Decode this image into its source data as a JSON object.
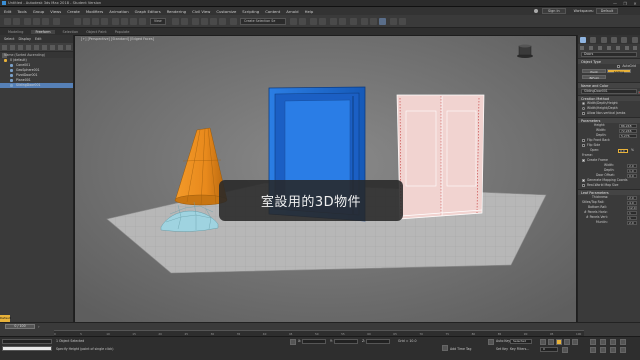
{
  "window": {
    "title": "Untitled - Autodesk 3ds Max 2018 - Student Version",
    "controls": [
      "—",
      "❐",
      "✕"
    ]
  },
  "menubar": {
    "items": [
      "Edit",
      "Tools",
      "Group",
      "Views",
      "Create",
      "Modifiers",
      "Animation",
      "Graph Editors",
      "Rendering",
      "Civil View",
      "Customize",
      "Scripting",
      "Content",
      "Arnold",
      "Help"
    ],
    "sign_in": "Sign In",
    "workspaces_label": "Workspaces:",
    "workspace_value": "Default"
  },
  "toolbar": {
    "view_dropdown": "View",
    "selection_set": "Create Selection Se"
  },
  "ribbon": {
    "tabs": [
      "Modeling",
      "Freeform",
      "Selection",
      "Object Paint",
      "Populate"
    ],
    "active_index": 1
  },
  "scene_explorer": {
    "tabs": [
      "Select",
      "Display",
      "Edit"
    ],
    "header": "Name (Sorted Ascending)",
    "root": "0 (default)",
    "items": [
      {
        "name": "Cone001",
        "selected": false
      },
      {
        "name": "GeoSphere001",
        "selected": false
      },
      {
        "name": "PivotDoor001",
        "selected": false
      },
      {
        "name": "Plane001",
        "selected": false
      },
      {
        "name": "SlidingDoor001",
        "selected": true
      }
    ]
  },
  "viewport": {
    "label": "[+] [Perspective] [Standard] [Edged Faces]",
    "subtitle": "室設用的3D物件"
  },
  "command_panel": {
    "category_dropdown": "Doors",
    "object_type": {
      "title": "Object Type",
      "autogrid": "AutoGrid",
      "buttons": [
        "Pivot",
        "Sliding",
        "BiFold"
      ],
      "active": "Sliding"
    },
    "name_and_color": {
      "title": "Name and Color",
      "name": "SlidingDoor001"
    },
    "creation_method": {
      "title": "Creation Method",
      "options": [
        "Width/Depth/Height",
        "Width/Height/Depth"
      ],
      "selected_index": 0,
      "allow_non_vertical": "Allow Non-vertical Jambs"
    },
    "parameters": {
      "title": "Parameters",
      "height_label": "Height:",
      "height": "86.248",
      "width_label": "Width:",
      "width": "72.246",
      "depth_label": "Depth:",
      "depth": "5.276",
      "flip_front_back": "Flip Front Back",
      "flip_side": "Flip Side",
      "open_label": "Open:",
      "open": "0.0",
      "open_unit": "%",
      "frame_label": "Frame:",
      "create_frame": "Create Frame",
      "frame_width_label": "Width:",
      "frame_width": "2.0",
      "frame_depth_label": "Depth:",
      "frame_depth": "1.0",
      "door_offset_label": "Door Offset:",
      "door_offset": "0.0",
      "generate_mapping": "Generate Mapping Coords",
      "real_world": "Real-World Map Size"
    },
    "leaf_parameters": {
      "title": "Leaf Parameters",
      "thickness_label": "Thickness:",
      "thickness": "2.0",
      "stiles_label": "Stiles/Top Rail:",
      "stiles": "4.0",
      "bottom_rail_label": "Bottom Rail:",
      "bottom_rail": "12.0",
      "panels_horiz_label": "# Panels Horiz:",
      "panels_horiz": "1",
      "panels_vert_label": "# Panels Vert:",
      "panels_vert": "1",
      "muntin_label": "Muntin:",
      "muntin": "2.0"
    }
  },
  "timeline": {
    "frame": "0 / 100",
    "orange_tab": "Default",
    "ticks": [
      "0",
      "5",
      "10",
      "15",
      "20",
      "25",
      "30",
      "35",
      "40",
      "45",
      "50",
      "55",
      "60",
      "65",
      "70",
      "75",
      "80",
      "85",
      "90",
      "95",
      "100"
    ]
  },
  "status_bar": {
    "selection": "1 Object Selected",
    "prompt": "Specify Height (point of single click)",
    "x_label": "X:",
    "y_label": "Y:",
    "z_label": "Z:",
    "grid": "Grid = 10.0",
    "add_time_tag": "Add Time Tag",
    "auto_key": "Auto Key",
    "selected": "Selected",
    "set_key": "Set Key",
    "key_filters": "Key Filters...",
    "frame_field": "0"
  },
  "colors": {
    "accent": "#e8b23a",
    "selection": "#5680b6",
    "viewport_bg": "#6b6b6b",
    "door_blue": "#1f6fd8",
    "cone_orange": "#e8891c",
    "sphere_teal": "#9fd3e0",
    "door_pink": "#f1d3d0"
  }
}
